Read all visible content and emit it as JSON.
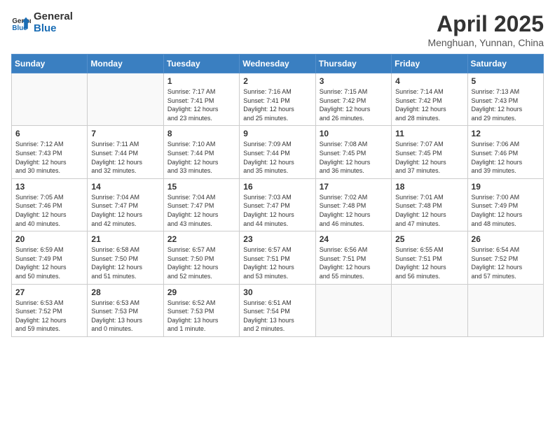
{
  "header": {
    "logo_line1": "General",
    "logo_line2": "Blue",
    "month_title": "April 2025",
    "location": "Menghuan, Yunnan, China"
  },
  "weekdays": [
    "Sunday",
    "Monday",
    "Tuesday",
    "Wednesday",
    "Thursday",
    "Friday",
    "Saturday"
  ],
  "weeks": [
    [
      {
        "day": "",
        "info": ""
      },
      {
        "day": "",
        "info": ""
      },
      {
        "day": "1",
        "info": "Sunrise: 7:17 AM\nSunset: 7:41 PM\nDaylight: 12 hours\nand 23 minutes."
      },
      {
        "day": "2",
        "info": "Sunrise: 7:16 AM\nSunset: 7:41 PM\nDaylight: 12 hours\nand 25 minutes."
      },
      {
        "day": "3",
        "info": "Sunrise: 7:15 AM\nSunset: 7:42 PM\nDaylight: 12 hours\nand 26 minutes."
      },
      {
        "day": "4",
        "info": "Sunrise: 7:14 AM\nSunset: 7:42 PM\nDaylight: 12 hours\nand 28 minutes."
      },
      {
        "day": "5",
        "info": "Sunrise: 7:13 AM\nSunset: 7:43 PM\nDaylight: 12 hours\nand 29 minutes."
      }
    ],
    [
      {
        "day": "6",
        "info": "Sunrise: 7:12 AM\nSunset: 7:43 PM\nDaylight: 12 hours\nand 30 minutes."
      },
      {
        "day": "7",
        "info": "Sunrise: 7:11 AM\nSunset: 7:44 PM\nDaylight: 12 hours\nand 32 minutes."
      },
      {
        "day": "8",
        "info": "Sunrise: 7:10 AM\nSunset: 7:44 PM\nDaylight: 12 hours\nand 33 minutes."
      },
      {
        "day": "9",
        "info": "Sunrise: 7:09 AM\nSunset: 7:44 PM\nDaylight: 12 hours\nand 35 minutes."
      },
      {
        "day": "10",
        "info": "Sunrise: 7:08 AM\nSunset: 7:45 PM\nDaylight: 12 hours\nand 36 minutes."
      },
      {
        "day": "11",
        "info": "Sunrise: 7:07 AM\nSunset: 7:45 PM\nDaylight: 12 hours\nand 37 minutes."
      },
      {
        "day": "12",
        "info": "Sunrise: 7:06 AM\nSunset: 7:46 PM\nDaylight: 12 hours\nand 39 minutes."
      }
    ],
    [
      {
        "day": "13",
        "info": "Sunrise: 7:05 AM\nSunset: 7:46 PM\nDaylight: 12 hours\nand 40 minutes."
      },
      {
        "day": "14",
        "info": "Sunrise: 7:04 AM\nSunset: 7:47 PM\nDaylight: 12 hours\nand 42 minutes."
      },
      {
        "day": "15",
        "info": "Sunrise: 7:04 AM\nSunset: 7:47 PM\nDaylight: 12 hours\nand 43 minutes."
      },
      {
        "day": "16",
        "info": "Sunrise: 7:03 AM\nSunset: 7:47 PM\nDaylight: 12 hours\nand 44 minutes."
      },
      {
        "day": "17",
        "info": "Sunrise: 7:02 AM\nSunset: 7:48 PM\nDaylight: 12 hours\nand 46 minutes."
      },
      {
        "day": "18",
        "info": "Sunrise: 7:01 AM\nSunset: 7:48 PM\nDaylight: 12 hours\nand 47 minutes."
      },
      {
        "day": "19",
        "info": "Sunrise: 7:00 AM\nSunset: 7:49 PM\nDaylight: 12 hours\nand 48 minutes."
      }
    ],
    [
      {
        "day": "20",
        "info": "Sunrise: 6:59 AM\nSunset: 7:49 PM\nDaylight: 12 hours\nand 50 minutes."
      },
      {
        "day": "21",
        "info": "Sunrise: 6:58 AM\nSunset: 7:50 PM\nDaylight: 12 hours\nand 51 minutes."
      },
      {
        "day": "22",
        "info": "Sunrise: 6:57 AM\nSunset: 7:50 PM\nDaylight: 12 hours\nand 52 minutes."
      },
      {
        "day": "23",
        "info": "Sunrise: 6:57 AM\nSunset: 7:51 PM\nDaylight: 12 hours\nand 53 minutes."
      },
      {
        "day": "24",
        "info": "Sunrise: 6:56 AM\nSunset: 7:51 PM\nDaylight: 12 hours\nand 55 minutes."
      },
      {
        "day": "25",
        "info": "Sunrise: 6:55 AM\nSunset: 7:51 PM\nDaylight: 12 hours\nand 56 minutes."
      },
      {
        "day": "26",
        "info": "Sunrise: 6:54 AM\nSunset: 7:52 PM\nDaylight: 12 hours\nand 57 minutes."
      }
    ],
    [
      {
        "day": "27",
        "info": "Sunrise: 6:53 AM\nSunset: 7:52 PM\nDaylight: 12 hours\nand 59 minutes."
      },
      {
        "day": "28",
        "info": "Sunrise: 6:53 AM\nSunset: 7:53 PM\nDaylight: 13 hours\nand 0 minutes."
      },
      {
        "day": "29",
        "info": "Sunrise: 6:52 AM\nSunset: 7:53 PM\nDaylight: 13 hours\nand 1 minute."
      },
      {
        "day": "30",
        "info": "Sunrise: 6:51 AM\nSunset: 7:54 PM\nDaylight: 13 hours\nand 2 minutes."
      },
      {
        "day": "",
        "info": ""
      },
      {
        "day": "",
        "info": ""
      },
      {
        "day": "",
        "info": ""
      }
    ]
  ]
}
